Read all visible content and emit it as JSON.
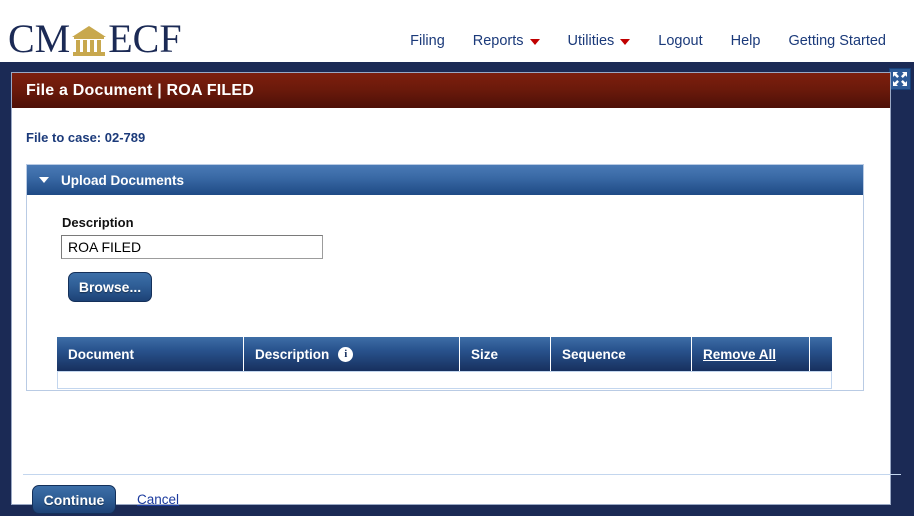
{
  "brand": {
    "name_left": "CM",
    "name_right": "ECF",
    "icon": "courthouse-icon"
  },
  "nav": {
    "items": [
      {
        "label": "Filing",
        "has_caret": false
      },
      {
        "label": "Reports",
        "has_caret": true
      },
      {
        "label": "Utilities",
        "has_caret": true
      },
      {
        "label": "Logout",
        "has_caret": false
      },
      {
        "label": "Help",
        "has_caret": false
      },
      {
        "label": "Getting Started",
        "has_caret": false
      }
    ]
  },
  "window": {
    "expand_icon": "expand-arrows-icon"
  },
  "card": {
    "header_title": "File a Document | ROA FILED",
    "file_to_case": "File to case: 02-789"
  },
  "panel": {
    "title": "Upload Documents",
    "collapse_icon": "chevron-down-icon",
    "description_label": "Description",
    "description_value": "ROA FILED",
    "description_placeholder": "",
    "browse_label": "Browse..."
  },
  "table": {
    "columns": [
      {
        "label": "Document",
        "icon": "",
        "link": false
      },
      {
        "label": "Description",
        "icon": "info-icon",
        "link": false
      },
      {
        "label": "Size",
        "icon": "",
        "link": false
      },
      {
        "label": "Sequence",
        "icon": "",
        "link": false
      },
      {
        "label": "Remove All",
        "icon": "",
        "link": true
      },
      {
        "label": "",
        "icon": "",
        "link": false
      }
    ],
    "rows": []
  },
  "footer": {
    "continue_label": "Continue",
    "cancel_label": "Cancel"
  },
  "colors": {
    "page_background": "#1b2a55",
    "card_header_red": "#6c1a0b",
    "panel_header_blue": "#2f5e96",
    "table_header_blue": "#17305e",
    "link_blue": "#1b3a9e",
    "caret_red": "#c00000",
    "logo_navy": "#1b2a55",
    "logo_gold": "#c8a84e"
  }
}
